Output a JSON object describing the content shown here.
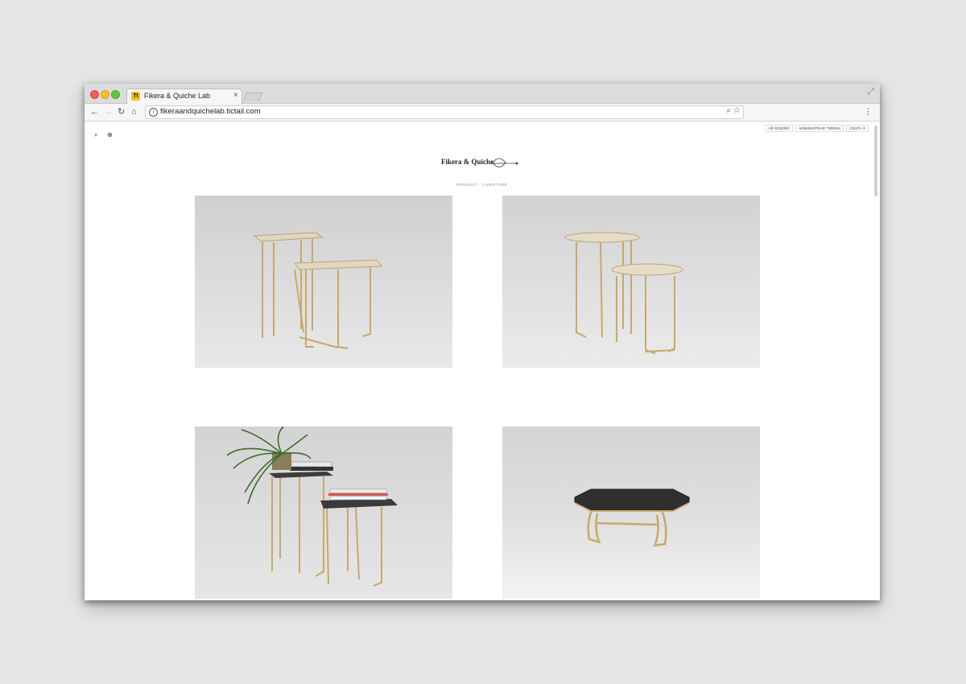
{
  "browser": {
    "tab_title": "Fikera & Quiche Lab",
    "favicon_text": "Tt",
    "url": "fikeraandquichelab.tictail.com"
  },
  "store": {
    "logo_text": "Fikera & Quiche",
    "top_links": [
      "AR DISEÑO",
      "ADMINISTRAR TIENDA",
      "CESTA 0"
    ],
    "breadcrumb": "PRODUCT   ·   FURNITURE"
  },
  "products": [
    {
      "name": "nesting-square-side-tables",
      "top_color": "#e3d6bf"
    },
    {
      "name": "nesting-round-side-tables",
      "top_color": "#e6dcc6"
    },
    {
      "name": "styled-hexagon-side-tables",
      "top_color": "#3a3a3a"
    },
    {
      "name": "octagon-coffee-table",
      "top_color": "#2f2f2f"
    }
  ],
  "colors": {
    "brass": "#c8a86a",
    "photo_bg": "#dadada"
  }
}
